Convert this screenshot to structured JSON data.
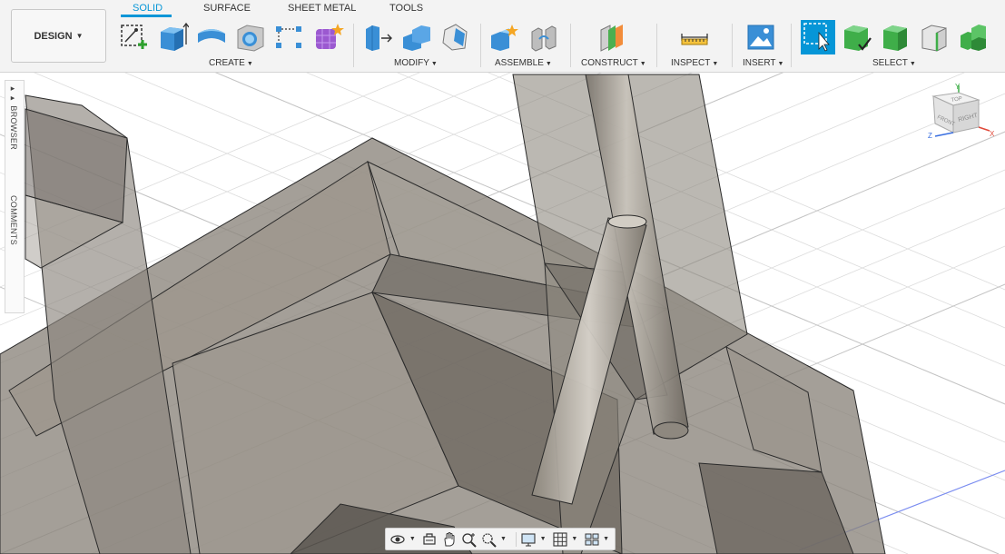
{
  "toolbar": {
    "workspace_button": "DESIGN",
    "tabs": [
      "SOLID",
      "SURFACE",
      "SHEET METAL",
      "TOOLS"
    ],
    "active_tab": "SOLID",
    "groups": {
      "create": "CREATE",
      "modify": "MODIFY",
      "assemble": "ASSEMBLE",
      "construct": "CONSTRUCT",
      "inspect": "INSPECT",
      "insert": "INSERT",
      "select": "SELECT"
    },
    "accent_color": "#0696d7"
  },
  "sidepanel": {
    "browser_label": "BROWSER",
    "comments_label": "COMMENTS"
  },
  "viewcube": {
    "top_face": "TOP",
    "front_face": "FRONT",
    "right_face": "RIGHT",
    "axis_x": "X",
    "axis_y": "Y",
    "axis_z": "Z"
  },
  "navbar": {
    "buttons": [
      "orbit-icon",
      "look-at-icon",
      "pan-icon",
      "zoom-icon",
      "fit-icon",
      "display-settings-icon",
      "grid-settings-icon",
      "viewports-icon"
    ]
  }
}
